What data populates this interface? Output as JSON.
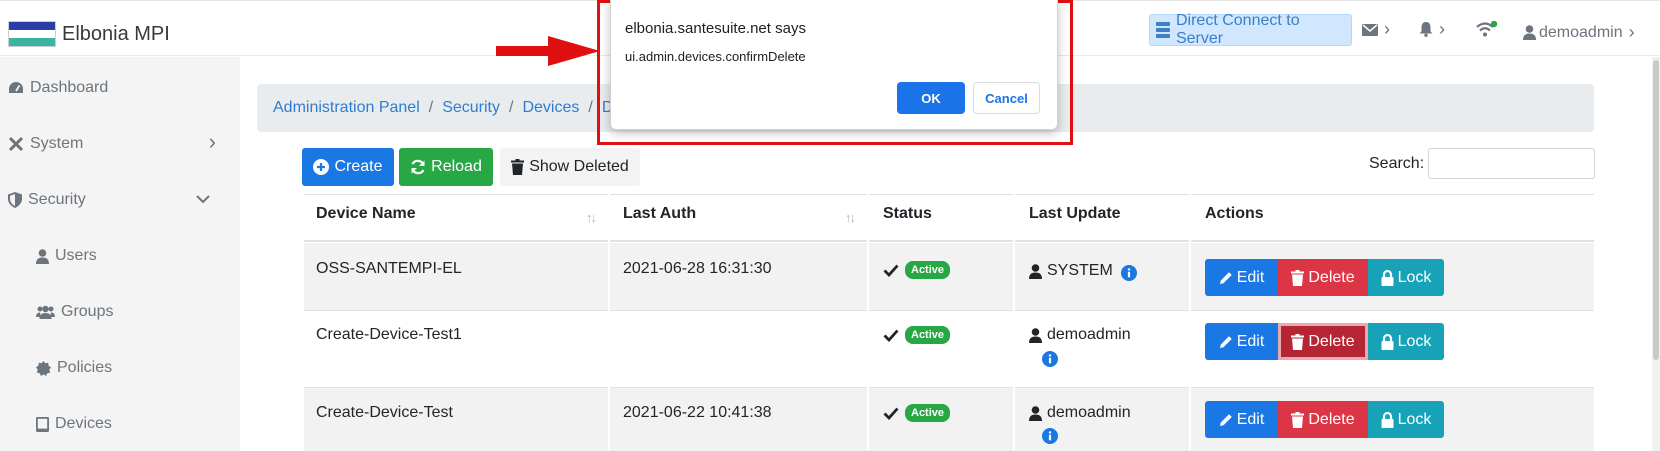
{
  "app": {
    "title": "Elbonia MPI",
    "flag_colors": [
      "#2a3ea8",
      "#ffffff",
      "#3bb3a0"
    ]
  },
  "topbar": {
    "direct_connect": "Direct Connect to Server",
    "user": "demoadmin",
    "status_color": "#28a745"
  },
  "sidebar": {
    "items": [
      {
        "label": "Dashboard",
        "icon": "tachometer-icon"
      },
      {
        "label": "System",
        "icon": "tools-icon",
        "chevron": "right"
      },
      {
        "label": "Security",
        "icon": "shield-icon",
        "chevron": "down"
      },
      {
        "label": "Users",
        "icon": "user-icon"
      },
      {
        "label": "Groups",
        "icon": "users-icon"
      },
      {
        "label": "Policies",
        "icon": "certificate-icon"
      },
      {
        "label": "Devices",
        "icon": "tablet-icon"
      }
    ]
  },
  "breadcrumb": {
    "items": [
      "Administration Panel",
      "Security",
      "Devices",
      "D"
    ],
    "separator": "/"
  },
  "toolbar": {
    "create": "Create",
    "reload": "Reload",
    "show_deleted": "Show Deleted",
    "search_label": "Search:",
    "search_value": ""
  },
  "table": {
    "columns": [
      "Device Name",
      "Last Auth",
      "Status",
      "Last Update",
      "Actions"
    ],
    "rows": [
      {
        "name": "OSS-SANTEMPI-EL",
        "last_auth": "2021-06-28 16:31:30",
        "status": "Active",
        "updated_by": "SYSTEM"
      },
      {
        "name": "Create-Device-Test1",
        "last_auth": "",
        "status": "Active",
        "updated_by": "demoadmin"
      },
      {
        "name": "Create-Device-Test",
        "last_auth": "2021-06-22 10:41:38",
        "status": "Active",
        "updated_by": "demoadmin"
      }
    ],
    "actions": {
      "edit": "Edit",
      "delete": "Delete",
      "lock": "Lock"
    }
  },
  "dialog": {
    "title": "elbonia.santesuite.net says",
    "message": "ui.admin.devices.confirmDelete",
    "ok": "OK",
    "cancel": "Cancel"
  }
}
